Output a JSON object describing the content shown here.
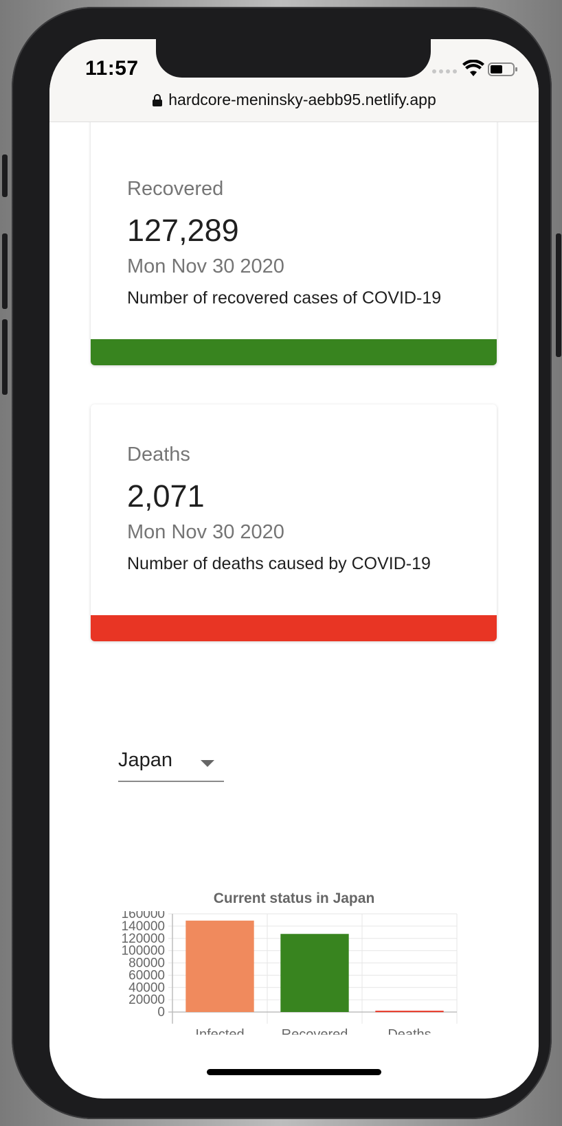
{
  "status_bar": {
    "time": "11:57"
  },
  "browser": {
    "url": "hardcore-meninsky-aebb95.netlify.app"
  },
  "cards": [
    {
      "title": "Recovered",
      "value": "127,289",
      "date": "Mon Nov 30 2020",
      "description": "Number of recovered cases of COVID-19",
      "bar_color": "#38841f"
    },
    {
      "title": "Deaths",
      "value": "2,071",
      "date": "Mon Nov 30 2020",
      "description": "Number of deaths caused by COVID-19",
      "bar_color": "#e83524"
    }
  ],
  "country_select": {
    "value": "Japan"
  },
  "chart_data": {
    "type": "bar",
    "title": "Current status in Japan",
    "categories": [
      "Infected",
      "Recovered",
      "Deaths"
    ],
    "values": [
      149000,
      127289,
      2071
    ],
    "colors": [
      "#f08a5d",
      "#38841f",
      "#e83524"
    ],
    "ylim": [
      0,
      160000
    ],
    "yticks": [
      "160000",
      "140000",
      "120000",
      "100000",
      "80000",
      "60000",
      "40000",
      "20000",
      "0"
    ],
    "grid": true,
    "xlabel": "",
    "ylabel": ""
  },
  "icons": [
    "lock-icon",
    "wifi-icon",
    "battery-icon",
    "dropdown-arrow-icon"
  ]
}
